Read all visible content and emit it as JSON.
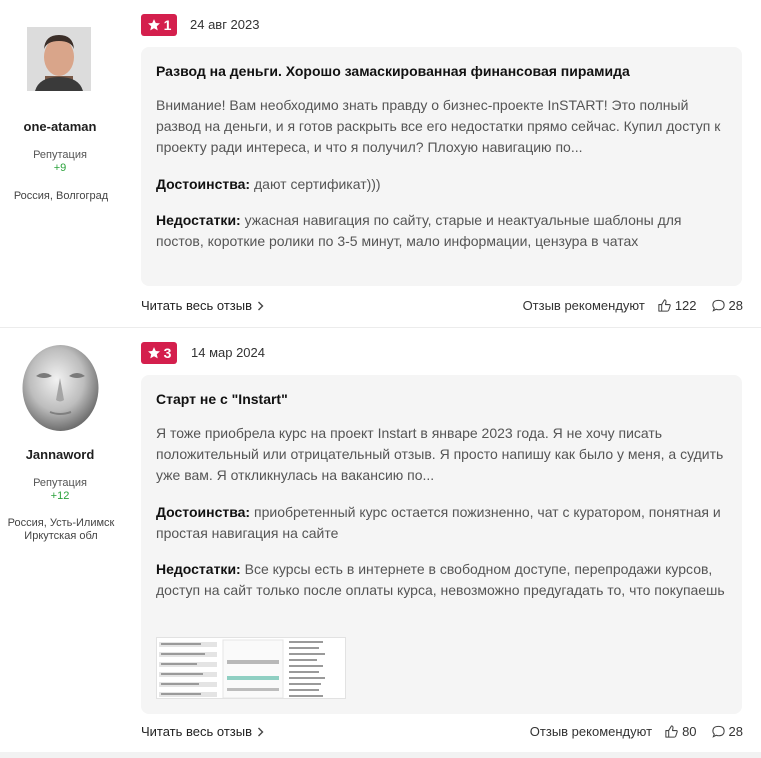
{
  "reviews": [
    {
      "username": "one-ataman",
      "reputation_label": "Репутация",
      "reputation_value": "+9",
      "location": "Россия, Волгоград",
      "rating": "1",
      "date": "24 авг 2023",
      "title": "Развод на деньги. Хорошо замаскированная финансовая пирамида",
      "text": "Внимание! Вам необходимо знать правду о бизнес-проекте InSTART! Это полный развод на деньги, и я готов раскрыть все его недостатки прямо сейчас. Купил доступ к проекту ради интереса, и что я получил? Плохую навигацию по...",
      "pros_label": "Достоинства:",
      "pros": "дают сертификат)))",
      "cons_label": "Недостатки:",
      "cons": "ужасная навигация по сайту, старые и неактуальные шаблоны для постов, короткие ролики по 3-5 минут, мало информации, цензура в чатах",
      "read_more": "Читать весь отзыв",
      "recommend_label": "Отзыв рекомендуют",
      "likes": "122",
      "comments": "28"
    },
    {
      "username": "Jannaword",
      "reputation_label": "Репутация",
      "reputation_value": "+12",
      "location": "Россия, Усть-Илимск Иркутская обл",
      "rating": "3",
      "date": "14 мар 2024",
      "title": "Старт не с \"Instart\"",
      "text": "Я тоже приобрела курс на проект Instart в январе 2023 года. Я не хочу писать положительный или отрицательный отзыв. Я просто напишу как было у меня, а судить уже вам. Я откликнулась на вакансию по...",
      "pros_label": "Достоинства:",
      "pros": "приобретенный курс остается пожизненно, чат с куратором, понятная и простая навигация на сайте",
      "cons_label": "Недостатки:",
      "cons": "Все курсы есть в интернете в свободном доступе, перепродажи курсов, доступ на сайт только после оплаты курса, невозможно предугадать то, что покупаешь",
      "read_more": "Читать весь отзыв",
      "recommend_label": "Отзыв рекомендуют",
      "likes": "80",
      "comments": "28"
    }
  ],
  "colors": {
    "badge": "#d41f4d",
    "reputation": "#2aa23b",
    "card_bg": "#f5f5f5"
  },
  "icons": [
    "star-icon",
    "chevron-right-icon",
    "thumbs-up-icon",
    "comment-icon"
  ]
}
